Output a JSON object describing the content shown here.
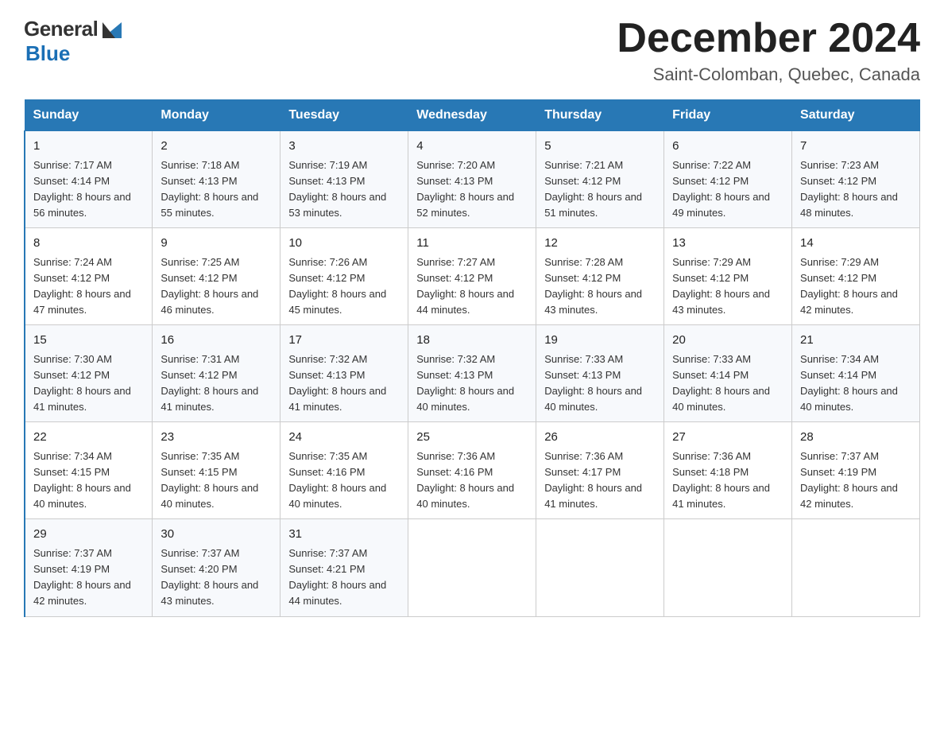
{
  "logo": {
    "text_general": "General",
    "text_blue": "Blue"
  },
  "title": {
    "month_year": "December 2024",
    "location": "Saint-Colomban, Quebec, Canada"
  },
  "headers": [
    "Sunday",
    "Monday",
    "Tuesday",
    "Wednesday",
    "Thursday",
    "Friday",
    "Saturday"
  ],
  "weeks": [
    [
      {
        "day": "1",
        "sunrise": "7:17 AM",
        "sunset": "4:14 PM",
        "daylight": "8 hours and 56 minutes."
      },
      {
        "day": "2",
        "sunrise": "7:18 AM",
        "sunset": "4:13 PM",
        "daylight": "8 hours and 55 minutes."
      },
      {
        "day": "3",
        "sunrise": "7:19 AM",
        "sunset": "4:13 PM",
        "daylight": "8 hours and 53 minutes."
      },
      {
        "day": "4",
        "sunrise": "7:20 AM",
        "sunset": "4:13 PM",
        "daylight": "8 hours and 52 minutes."
      },
      {
        "day": "5",
        "sunrise": "7:21 AM",
        "sunset": "4:12 PM",
        "daylight": "8 hours and 51 minutes."
      },
      {
        "day": "6",
        "sunrise": "7:22 AM",
        "sunset": "4:12 PM",
        "daylight": "8 hours and 49 minutes."
      },
      {
        "day": "7",
        "sunrise": "7:23 AM",
        "sunset": "4:12 PM",
        "daylight": "8 hours and 48 minutes."
      }
    ],
    [
      {
        "day": "8",
        "sunrise": "7:24 AM",
        "sunset": "4:12 PM",
        "daylight": "8 hours and 47 minutes."
      },
      {
        "day": "9",
        "sunrise": "7:25 AM",
        "sunset": "4:12 PM",
        "daylight": "8 hours and 46 minutes."
      },
      {
        "day": "10",
        "sunrise": "7:26 AM",
        "sunset": "4:12 PM",
        "daylight": "8 hours and 45 minutes."
      },
      {
        "day": "11",
        "sunrise": "7:27 AM",
        "sunset": "4:12 PM",
        "daylight": "8 hours and 44 minutes."
      },
      {
        "day": "12",
        "sunrise": "7:28 AM",
        "sunset": "4:12 PM",
        "daylight": "8 hours and 43 minutes."
      },
      {
        "day": "13",
        "sunrise": "7:29 AM",
        "sunset": "4:12 PM",
        "daylight": "8 hours and 43 minutes."
      },
      {
        "day": "14",
        "sunrise": "7:29 AM",
        "sunset": "4:12 PM",
        "daylight": "8 hours and 42 minutes."
      }
    ],
    [
      {
        "day": "15",
        "sunrise": "7:30 AM",
        "sunset": "4:12 PM",
        "daylight": "8 hours and 41 minutes."
      },
      {
        "day": "16",
        "sunrise": "7:31 AM",
        "sunset": "4:12 PM",
        "daylight": "8 hours and 41 minutes."
      },
      {
        "day": "17",
        "sunrise": "7:32 AM",
        "sunset": "4:13 PM",
        "daylight": "8 hours and 41 minutes."
      },
      {
        "day": "18",
        "sunrise": "7:32 AM",
        "sunset": "4:13 PM",
        "daylight": "8 hours and 40 minutes."
      },
      {
        "day": "19",
        "sunrise": "7:33 AM",
        "sunset": "4:13 PM",
        "daylight": "8 hours and 40 minutes."
      },
      {
        "day": "20",
        "sunrise": "7:33 AM",
        "sunset": "4:14 PM",
        "daylight": "8 hours and 40 minutes."
      },
      {
        "day": "21",
        "sunrise": "7:34 AM",
        "sunset": "4:14 PM",
        "daylight": "8 hours and 40 minutes."
      }
    ],
    [
      {
        "day": "22",
        "sunrise": "7:34 AM",
        "sunset": "4:15 PM",
        "daylight": "8 hours and 40 minutes."
      },
      {
        "day": "23",
        "sunrise": "7:35 AM",
        "sunset": "4:15 PM",
        "daylight": "8 hours and 40 minutes."
      },
      {
        "day": "24",
        "sunrise": "7:35 AM",
        "sunset": "4:16 PM",
        "daylight": "8 hours and 40 minutes."
      },
      {
        "day": "25",
        "sunrise": "7:36 AM",
        "sunset": "4:16 PM",
        "daylight": "8 hours and 40 minutes."
      },
      {
        "day": "26",
        "sunrise": "7:36 AM",
        "sunset": "4:17 PM",
        "daylight": "8 hours and 41 minutes."
      },
      {
        "day": "27",
        "sunrise": "7:36 AM",
        "sunset": "4:18 PM",
        "daylight": "8 hours and 41 minutes."
      },
      {
        "day": "28",
        "sunrise": "7:37 AM",
        "sunset": "4:19 PM",
        "daylight": "8 hours and 42 minutes."
      }
    ],
    [
      {
        "day": "29",
        "sunrise": "7:37 AM",
        "sunset": "4:19 PM",
        "daylight": "8 hours and 42 minutes."
      },
      {
        "day": "30",
        "sunrise": "7:37 AM",
        "sunset": "4:20 PM",
        "daylight": "8 hours and 43 minutes."
      },
      {
        "day": "31",
        "sunrise": "7:37 AM",
        "sunset": "4:21 PM",
        "daylight": "8 hours and 44 minutes."
      },
      null,
      null,
      null,
      null
    ]
  ]
}
